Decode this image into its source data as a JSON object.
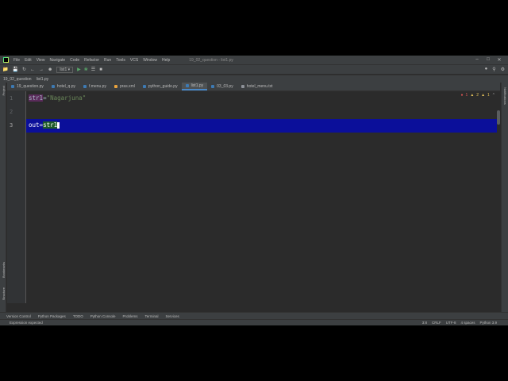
{
  "window": {
    "title": "19_02_question - list1.py",
    "menu": [
      "File",
      "Edit",
      "View",
      "Navigate",
      "Code",
      "Refactor",
      "Run",
      "Tools",
      "VCS",
      "Window",
      "Help"
    ]
  },
  "toolbar": {
    "run_config": "list1"
  },
  "navbar": {
    "project": "19_02_question",
    "file": "list1.py"
  },
  "left_panel": {
    "project_label": "Project",
    "bookmarks_label": "Bookmarks",
    "structure_label": "Structure"
  },
  "right_panel": {
    "notifications_label": "Notifications"
  },
  "tabs": [
    {
      "label": "19_question.py",
      "type": "py",
      "active": false
    },
    {
      "label": "hotel_q.py",
      "type": "py",
      "active": false
    },
    {
      "label": "f.menu.py",
      "type": "py",
      "active": false
    },
    {
      "label": "pras.xml",
      "type": "xml",
      "active": false
    },
    {
      "label": "python_guide.py",
      "type": "py",
      "active": false
    },
    {
      "label": "list1.py",
      "type": "py",
      "active": true
    },
    {
      "label": "03_03.py",
      "type": "py",
      "active": false
    },
    {
      "label": "hotel_menu.txt",
      "type": "txt",
      "active": false
    }
  ],
  "editor": {
    "line_numbers": [
      "1",
      "2",
      "3"
    ],
    "line1": {
      "var": "str1",
      "op": "=",
      "value": "\"Nagarjuna\""
    },
    "line3": {
      "var": "out",
      "op": "=",
      "value": "str1"
    },
    "inspections": {
      "errors": "1",
      "warnings": "2",
      "weak": "1"
    }
  },
  "tool_windows": [
    "Version Control",
    "Python Packages",
    "TODO",
    "Python Console",
    "Problems",
    "Terminal",
    "Services"
  ],
  "status": {
    "message": "Expression expected",
    "position": "3:8",
    "line_sep": "CRLF",
    "encoding": "UTF-8",
    "indent": "4 spaces",
    "interpreter": "Python 3.9"
  }
}
